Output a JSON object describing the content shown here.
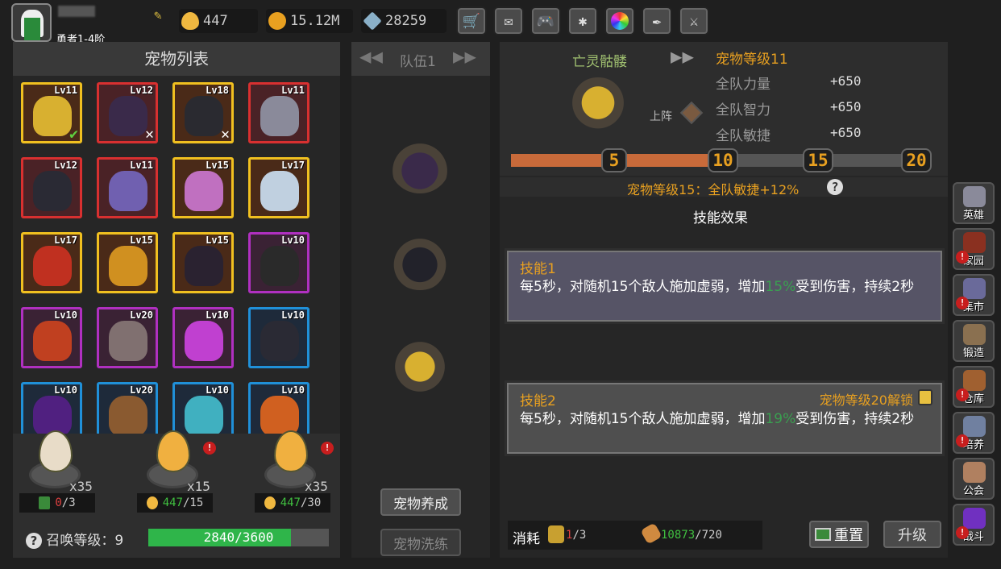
{
  "player": {
    "level_text": "勇者1-4阶"
  },
  "resources": {
    "eggs": "447",
    "gold": "15.12M",
    "gems": "28259"
  },
  "top_icons": [
    "cart-icon",
    "mail-icon",
    "gamepad-icon",
    "gear-icon",
    "color-wheel-icon",
    "feather-icon",
    "sword-icon"
  ],
  "left": {
    "title": "宠物列表",
    "pets": [
      {
        "lv": "Lv11",
        "border": "#f0c020",
        "bg": "#4a2a18",
        "color": "#d8b030",
        "checked": true
      },
      {
        "lv": "Lv12",
        "border": "#d83030",
        "bg": "#4a2226",
        "color": "#3a2a4a",
        "x": true
      },
      {
        "lv": "Lv18",
        "border": "#f0c020",
        "bg": "#4a2a18",
        "color": "#2a2a30",
        "x": true
      },
      {
        "lv": "Lv11",
        "border": "#d83030",
        "bg": "#4a2226",
        "color": "#8a8a9a"
      },
      {
        "lv": "Lv12",
        "border": "#d83030",
        "bg": "#4a2226",
        "color": "#2a2a34"
      },
      {
        "lv": "Lv11",
        "border": "#d83030",
        "bg": "#4a2226",
        "color": "#7060b0"
      },
      {
        "lv": "Lv15",
        "border": "#f0c020",
        "bg": "#4a2a18",
        "color": "#c070c0"
      },
      {
        "lv": "Lv17",
        "border": "#f0c020",
        "bg": "#4a2a18",
        "color": "#c0d0e0"
      },
      {
        "lv": "Lv17",
        "border": "#f0c020",
        "bg": "#4a2a18",
        "color": "#c03020"
      },
      {
        "lv": "Lv15",
        "border": "#f0c020",
        "bg": "#4a2a18",
        "color": "#d09020"
      },
      {
        "lv": "Lv15",
        "border": "#f0c020",
        "bg": "#4a2a18",
        "color": "#2a2230"
      },
      {
        "lv": "Lv10",
        "border": "#b030c0",
        "bg": "#3a2234",
        "color": "#2a2a2a"
      },
      {
        "lv": "Lv10",
        "border": "#b030c0",
        "bg": "#3a2234",
        "color": "#c04020"
      },
      {
        "lv": "Lv20",
        "border": "#b030c0",
        "bg": "#3a2234",
        "color": "#807070"
      },
      {
        "lv": "Lv10",
        "border": "#b030c0",
        "bg": "#3a2234",
        "color": "#c040d0"
      },
      {
        "lv": "Lv10",
        "border": "#2090d8",
        "bg": "#1e2a3a",
        "color": "#2a2a34"
      },
      {
        "lv": "Lv10",
        "border": "#2090d8",
        "bg": "#1e2a3a",
        "color": "#502080"
      },
      {
        "lv": "Lv20",
        "border": "#2090d8",
        "bg": "#1e2a3a",
        "color": "#8a5a30"
      },
      {
        "lv": "Lv10",
        "border": "#2090d8",
        "bg": "#1e2a3a",
        "color": "#40b0c0"
      },
      {
        "lv": "Lv10",
        "border": "#2090d8",
        "bg": "#1e2a3a",
        "color": "#d06020"
      }
    ],
    "eggs": [
      {
        "count": "x35",
        "alert": false,
        "cost_val": "0",
        "cost_max": "/3",
        "cost_color": "#e04040",
        "egg_color": "#e8dcc8"
      },
      {
        "count": "x15",
        "alert": true,
        "cost_val": "447",
        "cost_max": "/15",
        "cost_color": "#40c040",
        "egg_color": "#f0b040"
      },
      {
        "count": "x35",
        "alert": true,
        "cost_val": "447",
        "cost_max": "/30",
        "cost_color": "#40c040",
        "egg_color": "#f0b040"
      }
    ],
    "summon_label": "召唤等级：9",
    "summon_progress": "2840/3600",
    "summon_fraction": 0.789
  },
  "middle": {
    "team_label": "队伍1",
    "btn_train": "宠物养成",
    "btn_wash": "宠物洗练"
  },
  "right": {
    "pet_name": "亡灵骷髅",
    "pet_level": "宠物等级11",
    "deploy": "上阵",
    "stats": [
      {
        "name": "全队力量",
        "value": "+650"
      },
      {
        "name": "全队智力",
        "value": "+650"
      },
      {
        "name": "全队敏捷",
        "value": "+650"
      }
    ],
    "milestones": [
      "5",
      "10",
      "15",
      "20"
    ],
    "progress_level": 11,
    "bonus_text": "宠物等级15：全队敏捷+12%",
    "section_title": "技能效果",
    "skill1": {
      "name": "技能1",
      "desc_a": "每5秒，对随机15个敌人施加虚弱，增加",
      "pct": "15%",
      "desc_b": "受到伤害，持续2秒"
    },
    "skill2": {
      "name": "技能2",
      "unlock": "宠物等级20解锁",
      "desc_a": "每5秒，对随机15个敌人施加虚弱，增加",
      "pct": "19%",
      "desc_b": "受到伤害，持续2秒"
    },
    "cost_label": "消耗",
    "cost1_val": "1",
    "cost1_max": "/3",
    "cost2_val": "10873",
    "cost2_max": "/720",
    "btn_reset": "重置",
    "btn_upgrade": "升级"
  },
  "nav": [
    {
      "label": "英雄",
      "color": "#8a8a9a",
      "alert": false
    },
    {
      "label": "家园",
      "color": "#8a3020",
      "alert": true
    },
    {
      "label": "集市",
      "color": "#6a6a9a",
      "alert": true
    },
    {
      "label": "锻造",
      "color": "#8a7050",
      "alert": false
    },
    {
      "label": "仓库",
      "color": "#a06030",
      "alert": true
    },
    {
      "label": "培养",
      "color": "#7080a0",
      "alert": true
    },
    {
      "label": "公会",
      "color": "#b08060",
      "alert": false
    },
    {
      "label": "战斗",
      "color": "#7030c0",
      "alert": true
    }
  ]
}
